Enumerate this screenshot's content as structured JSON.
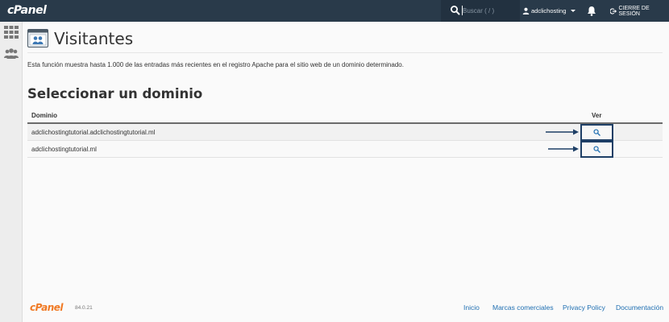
{
  "header": {
    "logo": "cPanel",
    "search": {
      "placeholder": "Buscar ( / )",
      "value": ""
    },
    "user": "adclichosting",
    "logout": "CIERRE DE SESIÓN"
  },
  "sidebar": {
    "items": [
      {
        "icon": "grid-icon"
      },
      {
        "icon": "users-icon"
      }
    ]
  },
  "page": {
    "title": "Visitantes",
    "description": "Esta función muestra hasta 1.000 de las entradas más recientes en el registro Apache para el sitio web de un dominio determinado.",
    "section_title": "Seleccionar un dominio"
  },
  "table": {
    "columns": [
      "Dominio",
      "Ver"
    ],
    "rows": [
      {
        "domain": "adclichostingtutorial.adclichostingtutorial.ml"
      },
      {
        "domain": "adclichostingtutorial.ml"
      }
    ]
  },
  "footer": {
    "logo": "cPanel",
    "version": "84.0.21",
    "links": [
      "Inicio",
      "Marcas comerciales",
      "Privacy Policy",
      "Documentación"
    ]
  },
  "colors": {
    "topbar": "#293a4a",
    "link": "#1f6fb2",
    "highlight_border": "#1e3f66",
    "footer_logo": "#f07a25"
  }
}
